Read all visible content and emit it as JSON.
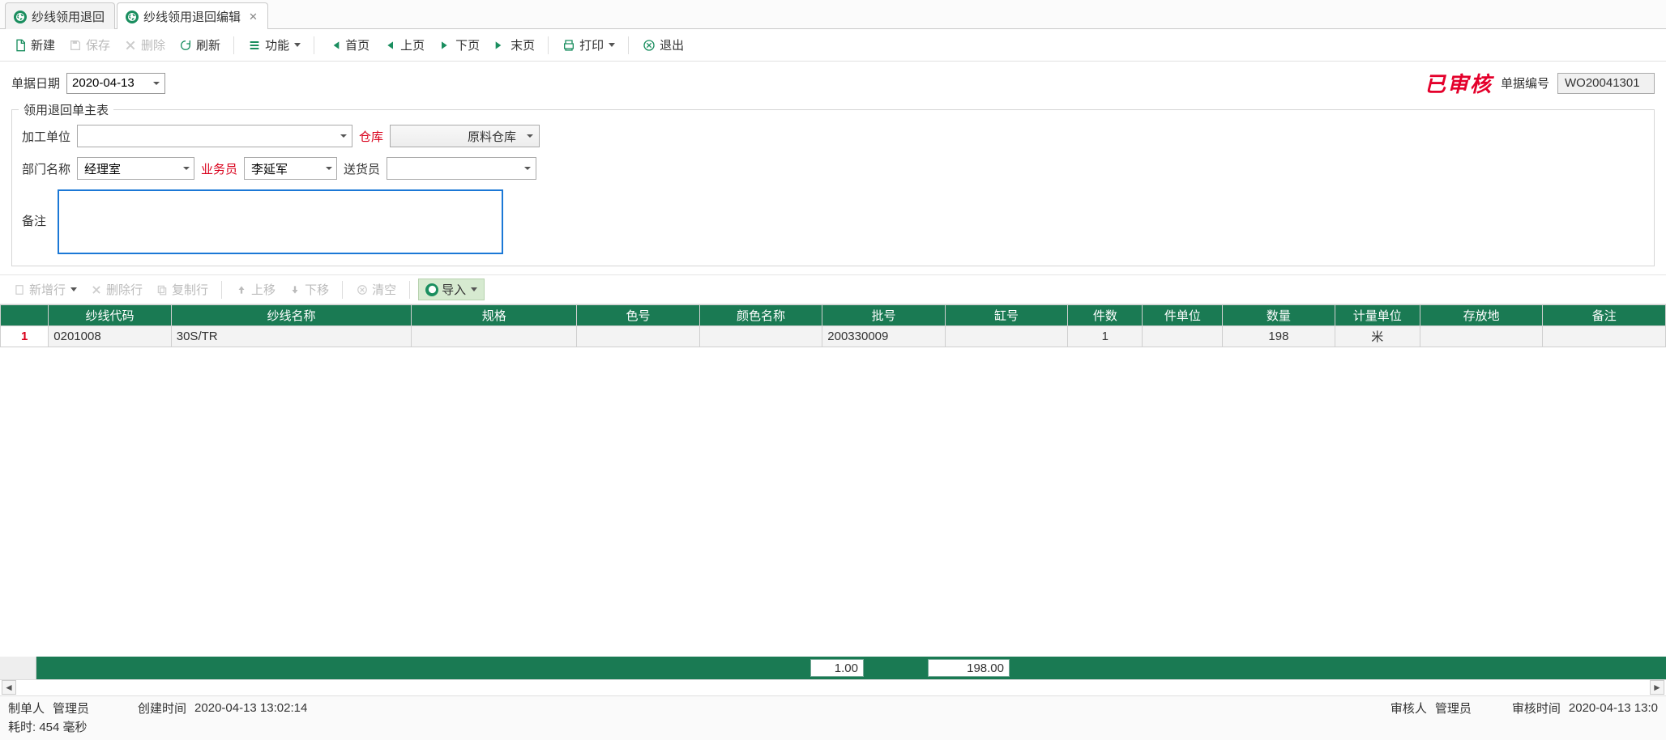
{
  "tabs": [
    {
      "label": "纱线领用退回",
      "active": false,
      "closable": false
    },
    {
      "label": "纱线领用退回编辑",
      "active": true,
      "closable": true
    }
  ],
  "toolbar": {
    "new": "新建",
    "save": "保存",
    "delete": "删除",
    "refresh": "刷新",
    "function": "功能",
    "first": "首页",
    "prev": "上页",
    "next": "下页",
    "last": "末页",
    "print": "打印",
    "exit": "退出"
  },
  "header": {
    "date_label": "单据日期",
    "date_value": "2020-04-13",
    "stamp": "已审核",
    "docno_label": "单据编号",
    "docno_value": "WO20041301"
  },
  "group": {
    "title": "领用退回单主表",
    "process_unit_label": "加工单位",
    "process_unit_value": "",
    "warehouse_label": "仓库",
    "warehouse_value": "原料仓库",
    "dept_label": "部门名称",
    "dept_value": "经理室",
    "salesman_label": "业务员",
    "salesman_value": "李延军",
    "deliverer_label": "送货员",
    "deliverer_value": "",
    "remarks_label": "备注",
    "remarks_value": ""
  },
  "grid_toolbar": {
    "add": "新增行",
    "delete": "删除行",
    "copy": "复制行",
    "up": "上移",
    "down": "下移",
    "clear": "清空",
    "import": "导入"
  },
  "grid": {
    "columns": [
      "",
      "纱线代码",
      "纱线名称",
      "规格",
      "色号",
      "颜色名称",
      "批号",
      "缸号",
      "件数",
      "件单位",
      "数量",
      "计量单位",
      "存放地",
      "备注"
    ],
    "widths": [
      45,
      115,
      225,
      155,
      115,
      115,
      115,
      115,
      70,
      75,
      105,
      80,
      115,
      115
    ],
    "rows": [
      {
        "rownum": "1",
        "cells": [
          "0201008",
          "30S/TR",
          "",
          "",
          "",
          "200330009",
          "",
          "1",
          "",
          "198",
          "米",
          "",
          ""
        ]
      }
    ]
  },
  "totals": {
    "qty": "1.00",
    "amount": "198.00"
  },
  "footer": {
    "creator_label": "制单人",
    "creator": "管理员",
    "create_time_label": "创建时间",
    "create_time": "2020-04-13 13:02:14",
    "auditor_label": "审核人",
    "auditor": "管理员",
    "audit_time_label": "审核时间",
    "audit_time": "2020-04-13 13:0",
    "elapsed": "耗时: 454 毫秒"
  }
}
